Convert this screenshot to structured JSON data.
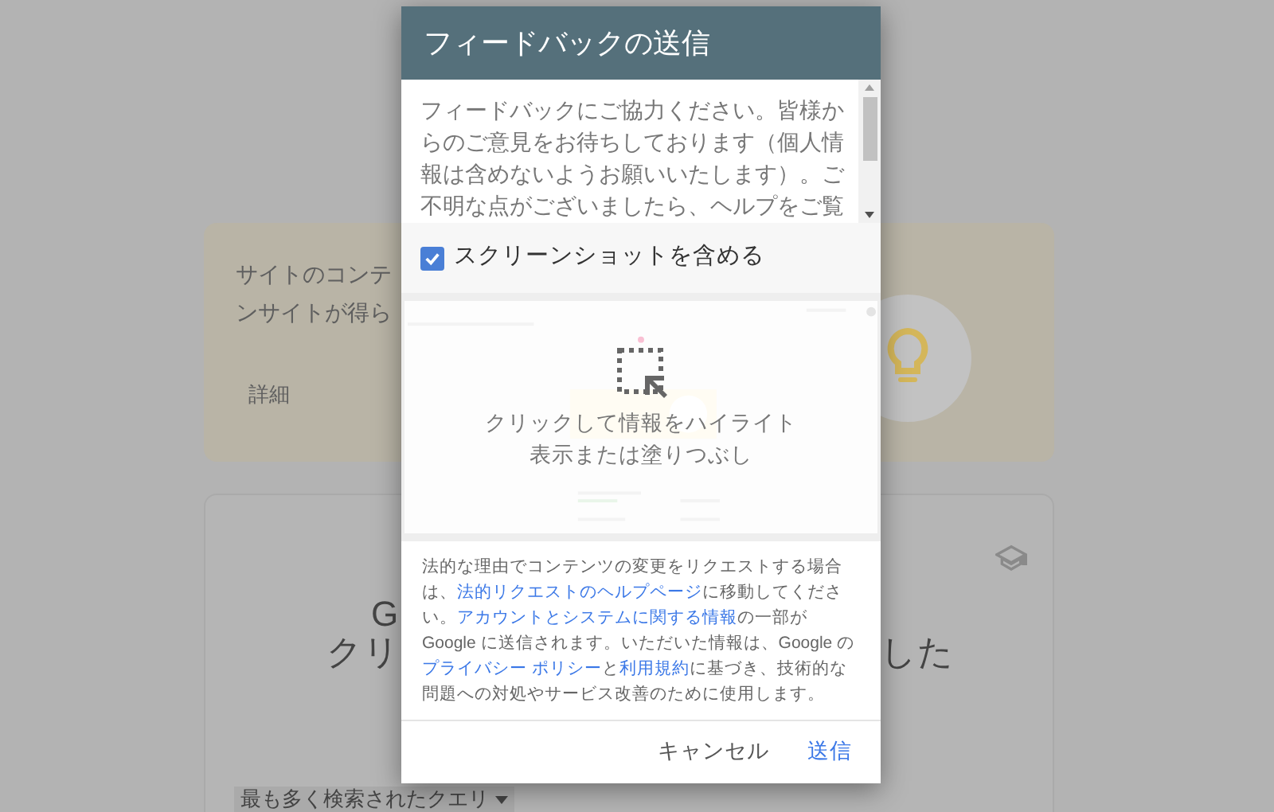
{
  "background": {
    "tip_card": {
      "lines": [
        "サイトのコンテ",
        "ンサイトが得ら"
      ],
      "link": "詳細"
    },
    "query_card": {
      "heading": "G",
      "subheading_left": "クリ",
      "subheading_right": "した",
      "dropdown": "最も多く検索されたクエリ"
    }
  },
  "dialog": {
    "title": "フィードバックの送信",
    "message": "フィードバックにご協力ください。皆様からのご意見をお待ちしております（個人情報は含めないようお願いいたします）。ご不明な点がございましたら、ヘルプをご覧",
    "include_screenshot": {
      "label": "スクリーンショットを含める",
      "checked": true
    },
    "screenshot_hint": "クリックして情報をハイライト表示または塗りつぶし",
    "legal": [
      {
        "kind": "text",
        "text": "法的な理由でコンテンツの変更をリクエストする場合は、"
      },
      {
        "kind": "link",
        "text": "法的リクエストのヘルプページ"
      },
      {
        "kind": "text",
        "text": "に移動してください。"
      },
      {
        "kind": "link",
        "text": "アカウントとシステムに関する情報"
      },
      {
        "kind": "text",
        "text": "の一部が Google に送信されます。いただいた情報は、Google の"
      },
      {
        "kind": "link",
        "text": "プライバシー ポリシー"
      },
      {
        "kind": "text",
        "text": "と"
      },
      {
        "kind": "link",
        "text": "利用規約"
      },
      {
        "kind": "text",
        "text": "に基づき、技術的な問題への対処やサービス改善のために使用します。"
      }
    ],
    "buttons": [
      {
        "label": "キャンセル",
        "kind": "secondary"
      },
      {
        "label": "送信",
        "kind": "primary"
      }
    ]
  }
}
